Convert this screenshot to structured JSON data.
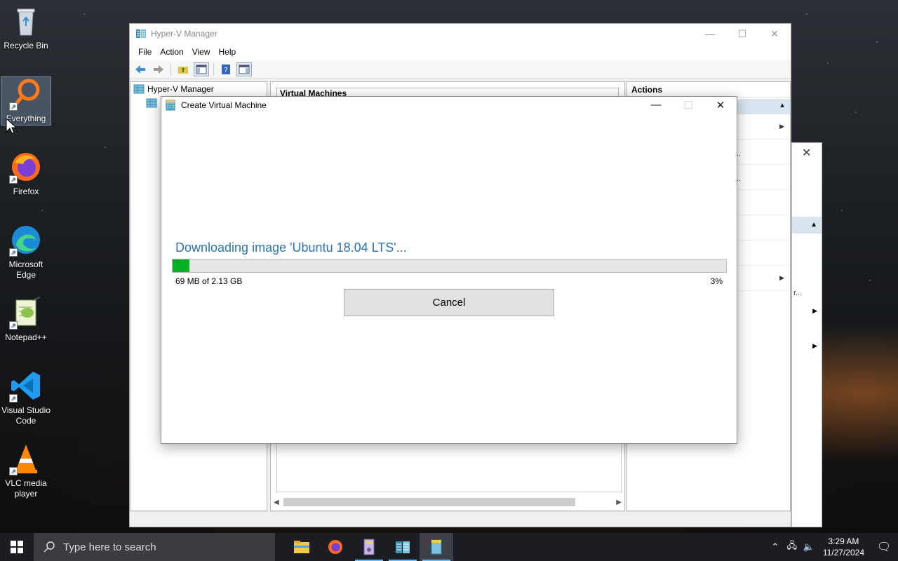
{
  "desktop": {
    "icons": [
      {
        "label": "Recycle Bin"
      },
      {
        "label": "Everything"
      },
      {
        "label": "Firefox"
      },
      {
        "label": "Microsoft Edge"
      },
      {
        "label": "Notepad++"
      },
      {
        "label": "Visual Studio Code"
      },
      {
        "label": "VLC media player"
      }
    ]
  },
  "hyperv": {
    "title": "Hyper-V Manager",
    "menu": [
      "File",
      "Action",
      "View",
      "Help"
    ],
    "tree_root": "Hyper-V Manager",
    "center_header": "Virtual Machines",
    "actions_title": "Actions",
    "ellipsis": "..."
  },
  "bg_dialog": {
    "partial_text": "r..."
  },
  "modal": {
    "title": "Create Virtual Machine",
    "message": "Downloading image 'Ubuntu 18.04 LTS'...",
    "progress_text": "69 MB of 2.13 GB",
    "progress_percent_label": "3%",
    "progress_fraction": 0.03,
    "cancel_label": "Cancel"
  },
  "taskbar": {
    "search_placeholder": "Type here to search",
    "time": "3:29 AM",
    "date": "11/27/2024"
  },
  "colors": {
    "accent_blue": "#2a74b8",
    "progress_green": "#06b025",
    "taskbar": "#1b1d22"
  }
}
